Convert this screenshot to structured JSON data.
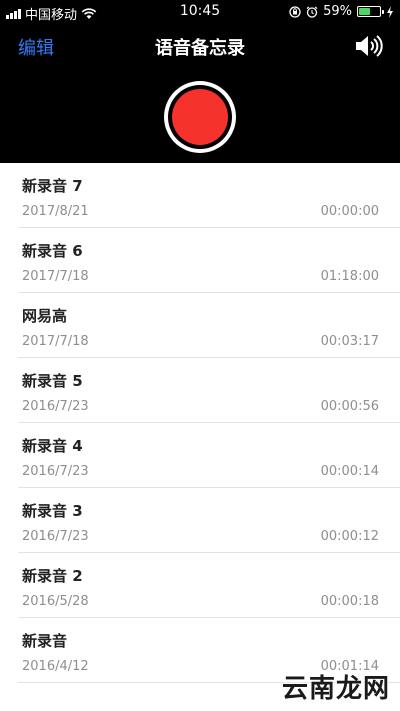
{
  "status_bar": {
    "carrier": "中国移动",
    "time": "10:45",
    "battery_percent": "59%",
    "battery_level": 0.59,
    "icons": [
      "signal-icon",
      "wifi-icon",
      "rotation-lock-icon",
      "alarm-icon",
      "battery-icon",
      "charging-icon"
    ]
  },
  "nav": {
    "edit_label": "编辑",
    "title": "语音备忘录",
    "speaker_icon": "speaker-icon"
  },
  "colors": {
    "header_bg": "#000000",
    "accent": "#2f7cf6",
    "record": "#f5322c",
    "battery": "#4cd964",
    "secondary_text": "#8e8e93"
  },
  "recordings": [
    {
      "name": "新录音 7",
      "date": "2017/8/21",
      "duration": "00:00:00"
    },
    {
      "name": "新录音 6",
      "date": "2017/7/18",
      "duration": "01:18:00"
    },
    {
      "name": "网易高",
      "date": "2017/7/18",
      "duration": "00:03:17"
    },
    {
      "name": "新录音 5",
      "date": "2016/7/23",
      "duration": "00:00:56"
    },
    {
      "name": "新录音 4",
      "date": "2016/7/23",
      "duration": "00:00:14"
    },
    {
      "name": "新录音 3",
      "date": "2016/7/23",
      "duration": "00:00:12"
    },
    {
      "name": "新录音 2",
      "date": "2016/5/28",
      "duration": "00:00:18"
    },
    {
      "name": "新录音",
      "date": "2016/4/12",
      "duration": "00:01:14"
    }
  ],
  "watermark": "云南龙网"
}
